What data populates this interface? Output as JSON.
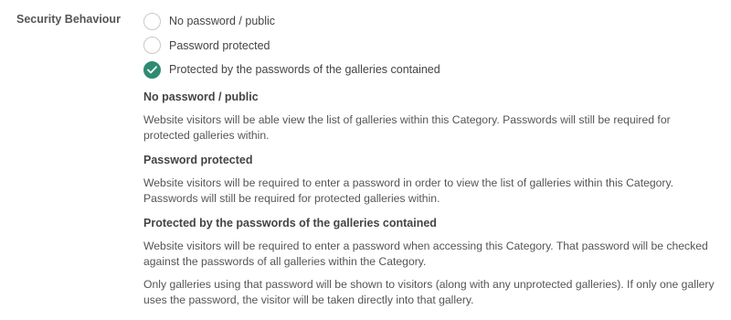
{
  "field": {
    "label": "Security Behaviour"
  },
  "options": [
    {
      "label": "No password / public",
      "checked": false
    },
    {
      "label": "Password protected",
      "checked": false
    },
    {
      "label": "Protected by the passwords of the galleries contained",
      "checked": true
    }
  ],
  "help": [
    {
      "title": "No password / public",
      "paragraphs": [
        "Website visitors will be able view the list of galleries within this Category. Passwords will still be required for protected galleries within."
      ]
    },
    {
      "title": "Password protected",
      "paragraphs": [
        "Website visitors will be required to enter a password in order to view the list of galleries within this Category. Passwords will still be required for protected galleries within."
      ]
    },
    {
      "title": "Protected by the passwords of the galleries contained",
      "paragraphs": [
        "Website visitors will be required to enter a password when accessing this Category. That password will be checked against the passwords of all galleries within the Category.",
        "Only galleries using that password will be shown to visitors (along with any unprotected galleries). If only one gallery uses the password, the visitor will be taken directly into that gallery."
      ]
    }
  ],
  "colors": {
    "accent": "#2e8b73",
    "radio_border": "#c8c8c8",
    "text": "#444444"
  },
  "icons": {
    "checked_radio": "check-icon"
  }
}
